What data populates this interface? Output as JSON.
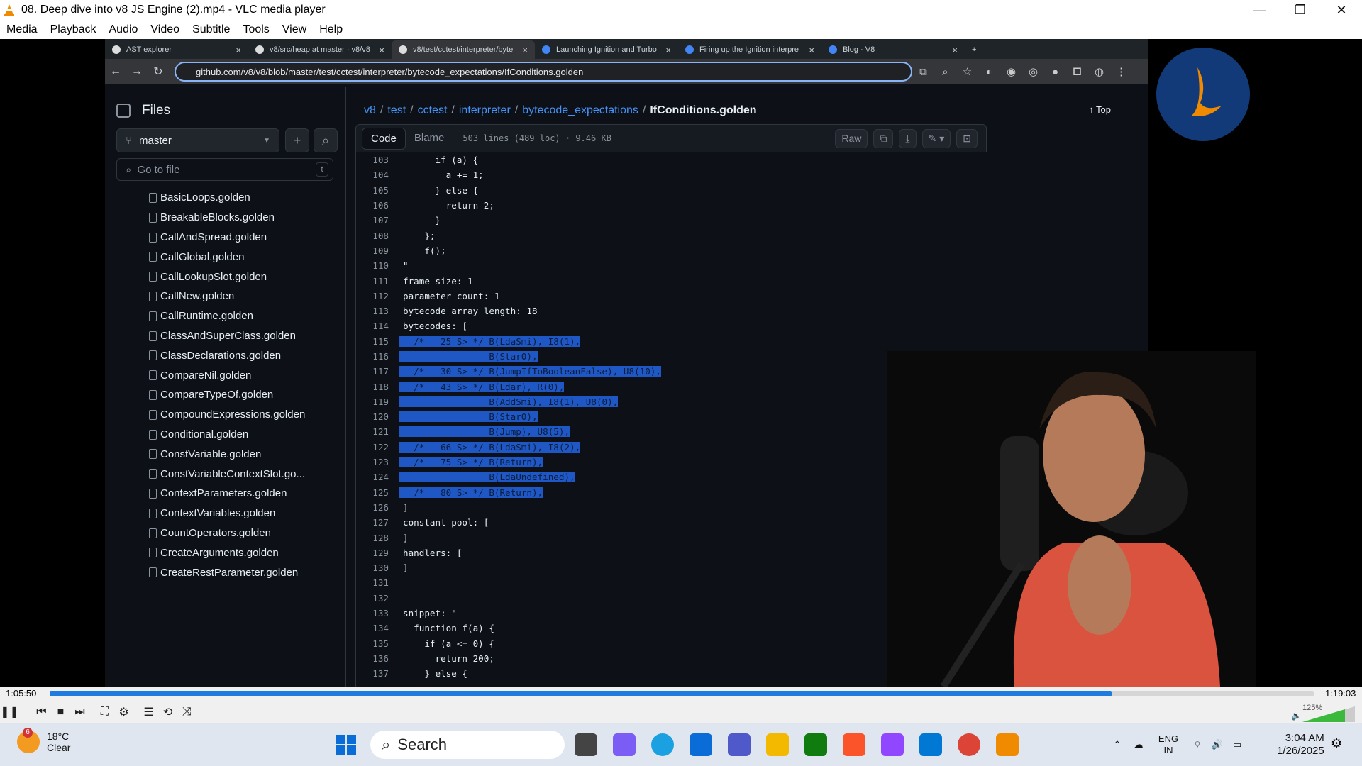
{
  "window": {
    "title": "08. Deep dive into v8 JS Engine (2).mp4 - VLC media player",
    "minimize": "—",
    "restore": "❐",
    "close": "✕"
  },
  "menu": [
    "Media",
    "Playback",
    "Audio",
    "Video",
    "Subtitle",
    "Tools",
    "View",
    "Help"
  ],
  "browser": {
    "tabs": [
      {
        "label": "AST explorer",
        "active": false
      },
      {
        "label": "v8/src/heap at master · v8/v8",
        "active": false
      },
      {
        "label": "v8/test/cctest/interpreter/byte",
        "active": true
      },
      {
        "label": "Launching Ignition and Turbo",
        "active": false
      },
      {
        "label": "Firing up the Ignition interpre",
        "active": false
      },
      {
        "label": "Blog · V8",
        "active": false
      }
    ],
    "url": "github.com/v8/v8/blob/master/test/cctest/interpreter/bytecode_expectations/IfConditions.golden"
  },
  "sidebar": {
    "title": "Files",
    "branch": "master",
    "goto_placeholder": "Go to file",
    "goto_key": "t",
    "files": [
      "BasicLoops.golden",
      "BreakableBlocks.golden",
      "CallAndSpread.golden",
      "CallGlobal.golden",
      "CallLookupSlot.golden",
      "CallNew.golden",
      "CallRuntime.golden",
      "ClassAndSuperClass.golden",
      "ClassDeclarations.golden",
      "CompareNil.golden",
      "CompareTypeOf.golden",
      "CompoundExpressions.golden",
      "Conditional.golden",
      "ConstVariable.golden",
      "ConstVariableContextSlot.go...",
      "ContextParameters.golden",
      "ContextVariables.golden",
      "CountOperators.golden",
      "CreateArguments.golden",
      "CreateRestParameter.golden"
    ]
  },
  "breadcrumb": [
    "v8",
    "test",
    "cctest",
    "interpreter",
    "bytecode_expectations",
    "IfConditions.golden"
  ],
  "top_link": "Top",
  "code_header": {
    "tab_code": "Code",
    "tab_blame": "Blame",
    "meta": "503 lines (489 loc) · 9.46 KB",
    "raw": "Raw"
  },
  "code_lines": [
    {
      "n": "103",
      "t": "      if (a) {",
      "s": false
    },
    {
      "n": "104",
      "t": "        a += 1;",
      "s": false
    },
    {
      "n": "105",
      "t": "      } else {",
      "s": false
    },
    {
      "n": "106",
      "t": "        return 2;",
      "s": false
    },
    {
      "n": "107",
      "t": "      }",
      "s": false
    },
    {
      "n": "108",
      "t": "    };",
      "s": false
    },
    {
      "n": "109",
      "t": "    f();",
      "s": false
    },
    {
      "n": "110",
      "t": "\"",
      "s": false
    },
    {
      "n": "111",
      "t": "frame size: 1",
      "s": false
    },
    {
      "n": "112",
      "t": "parameter count: 1",
      "s": false
    },
    {
      "n": "113",
      "t": "bytecode array length: 18",
      "s": false
    },
    {
      "n": "114",
      "t": "bytecodes: [",
      "s": false
    },
    {
      "n": "115",
      "t": "  /*   25 S> */ B(LdaSmi), I8(1),",
      "s": true
    },
    {
      "n": "116",
      "t": "                B(Star0),",
      "s": true
    },
    {
      "n": "117",
      "t": "  /*   30 S> */ B(JumpIfToBooleanFalse), U8(10),",
      "s": true
    },
    {
      "n": "118",
      "t": "  /*   43 S> */ B(Ldar), R(0),",
      "s": true
    },
    {
      "n": "119",
      "t": "                B(AddSmi), I8(1), U8(0),",
      "s": true
    },
    {
      "n": "120",
      "t": "                B(Star0),",
      "s": true
    },
    {
      "n": "121",
      "t": "                B(Jump), U8(5),",
      "s": true
    },
    {
      "n": "122",
      "t": "  /*   66 S> */ B(LdaSmi), I8(2),",
      "s": true
    },
    {
      "n": "123",
      "t": "  /*   75 S> */ B(Return),",
      "s": true
    },
    {
      "n": "124",
      "t": "                B(LdaUndefined),",
      "s": true
    },
    {
      "n": "125",
      "t": "  /*   80 S> */ B(Return),",
      "s": true
    },
    {
      "n": "126",
      "t": "]",
      "s": false
    },
    {
      "n": "127",
      "t": "constant pool: [",
      "s": false
    },
    {
      "n": "128",
      "t": "]",
      "s": false
    },
    {
      "n": "129",
      "t": "handlers: [",
      "s": false
    },
    {
      "n": "130",
      "t": "]",
      "s": false
    },
    {
      "n": "131",
      "t": "",
      "s": false
    },
    {
      "n": "132",
      "t": "---",
      "s": false
    },
    {
      "n": "133",
      "t": "snippet: \"",
      "s": false
    },
    {
      "n": "134",
      "t": "  function f(a) {",
      "s": false
    },
    {
      "n": "135",
      "t": "    if (a <= 0) {",
      "s": false
    },
    {
      "n": "136",
      "t": "      return 200;",
      "s": false
    },
    {
      "n": "137",
      "t": "    } else {",
      "s": false
    }
  ],
  "player": {
    "elapsed": "1:05:50",
    "total": "1:19:03",
    "progress": 0.84,
    "volume": "125%"
  },
  "taskbar": {
    "temp": "18°C",
    "cond": "Clear",
    "weather_badge": "6",
    "search": "Search",
    "lang": "ENG",
    "region": "IN",
    "time": "3:04 AM",
    "date": "1/26/2025"
  }
}
